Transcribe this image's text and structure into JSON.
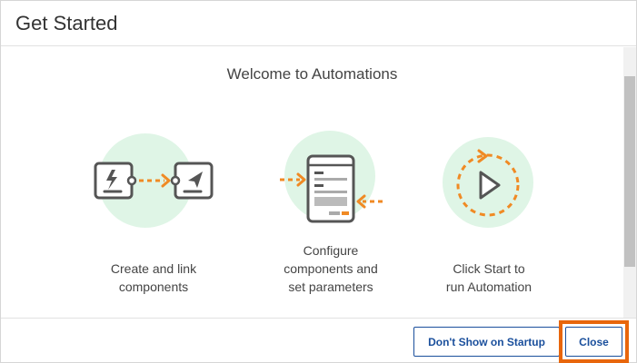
{
  "dialog": {
    "title": "Get Started",
    "welcome": "Welcome to Automations"
  },
  "steps": [
    {
      "line1": "Create and link",
      "line2": "components",
      "icon": "link-components-icon"
    },
    {
      "line1": "Configure",
      "line2": "components and",
      "line3": "set parameters",
      "icon": "configure-form-icon"
    },
    {
      "line1": "Click Start to",
      "line2": "run Automation",
      "icon": "play-icon"
    }
  ],
  "footer": {
    "dont_show_label": "Don't Show on Startup",
    "close_label": "Close"
  },
  "colors": {
    "accent_orange": "#f08a24",
    "circle_green": "#dff5e6",
    "button_blue": "#1a4f9c",
    "highlight_orange": "#e8660c",
    "icon_gray": "#555555"
  }
}
